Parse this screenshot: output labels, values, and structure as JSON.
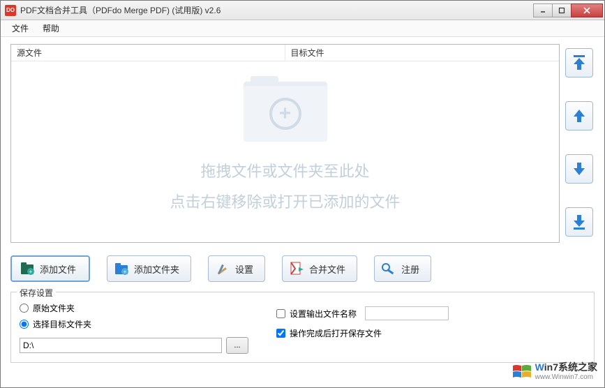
{
  "title": "PDF文档合并工具（PDFdo Merge PDF) (试用版) v2.6",
  "menu": {
    "file": "文件",
    "help": "帮助"
  },
  "cols": {
    "source": "源文件",
    "target": "目标文件"
  },
  "dropHint": {
    "line1": "拖拽文件或文件夹至此处",
    "line2": "点击右键移除或打开已添加的文件"
  },
  "toolbar": {
    "addFile": "添加文件",
    "addFolder": "添加文件夹",
    "settings": "设置",
    "merge": "合并文件",
    "register": "注册"
  },
  "save": {
    "legend": "保存设置",
    "origFolder": "原始文件夹",
    "chooseFolder": "选择目标文件夹",
    "path": "D:\\",
    "browse": "...",
    "setOutputName": "设置输出文件名称",
    "openAfter": "操作完成后打开保存文件"
  },
  "watermark": {
    "brand1": "W",
    "brand2": "in7系统之家",
    "url": "www.Winwin7.com"
  }
}
